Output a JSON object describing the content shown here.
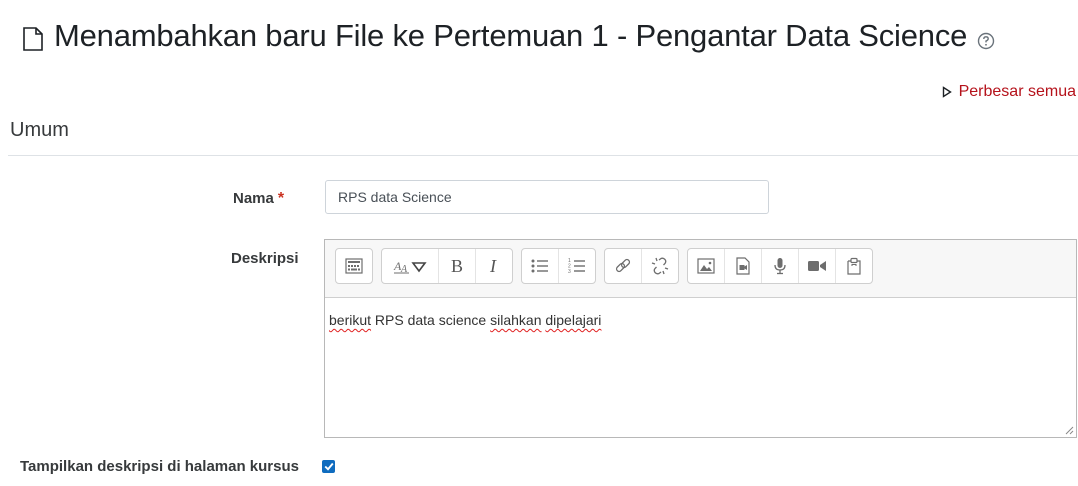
{
  "header": {
    "title": "Menambahkan baru File ke Pertemuan 1 - Pengantar Data Science",
    "expand_all_label": "Perbesar semua"
  },
  "section": {
    "title": "Umum"
  },
  "form": {
    "name_label": "Nama",
    "name_required_mark": "*",
    "name_value": "RPS data Science",
    "description_label": "Deskripsi",
    "description_words": [
      "berikut",
      "RPS data science",
      "silahkan",
      "dipelajari"
    ],
    "show_description_label": "Tampilkan deskripsi di halaman kursus",
    "show_description_checked": true
  },
  "editor_toolbar": {
    "groups": [
      [
        "toolbar-toggle-icon"
      ],
      [
        "font-style-dropdown-icon",
        "bold-icon",
        "italic-icon"
      ],
      [
        "unordered-list-icon",
        "ordered-list-icon"
      ],
      [
        "link-icon",
        "unlink-icon"
      ],
      [
        "image-icon",
        "media-icon",
        "record-audio-icon",
        "record-video-icon",
        "manage-files-icon"
      ]
    ]
  },
  "colors": {
    "accent": "#0f6cbf",
    "link_red": "#b5121b",
    "required": "#ca3120"
  }
}
